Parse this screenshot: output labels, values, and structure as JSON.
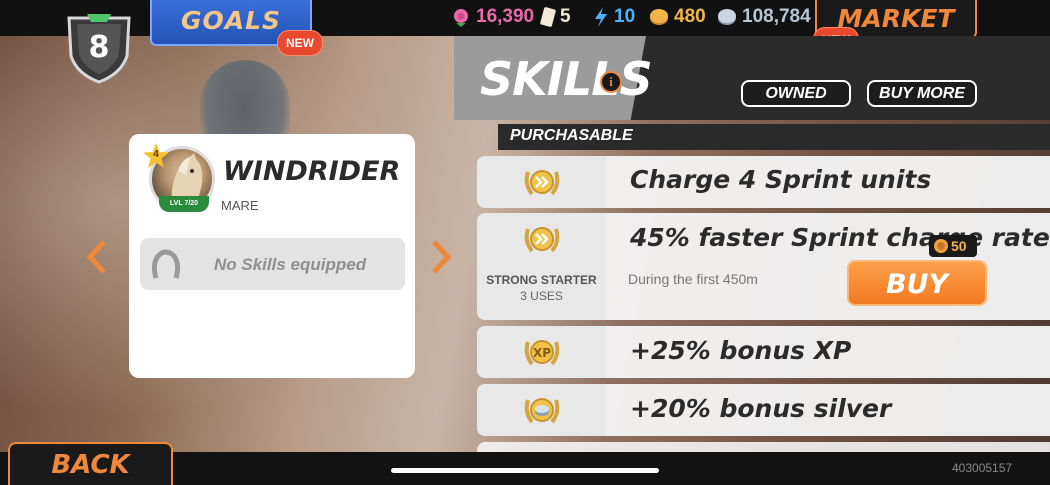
{
  "header": {
    "player_level": "8",
    "goals": {
      "label": "GOALS",
      "badge": "NEW"
    },
    "market": {
      "label": "MARKET",
      "badge": "NEW"
    },
    "resources": [
      {
        "icon": "rose-icon",
        "value": "16,390",
        "color": "#e86aa8"
      },
      {
        "icon": "ticket-icon",
        "value": "5",
        "color": "#f2ead8"
      },
      {
        "icon": "energy-icon",
        "value": "10",
        "color": "#4fb0ff"
      },
      {
        "icon": "gold-coin-icon",
        "value": "480",
        "color": "#f0b44a"
      },
      {
        "icon": "silver-coin-icon",
        "value": "108,784",
        "color": "#b7c7d3"
      }
    ]
  },
  "skills": {
    "title": "SKILLS",
    "owned_label": "OWNED",
    "buy_more_label": "BUY MORE",
    "section_label": "PURCHASABLE",
    "items": [
      {
        "title": "Charge 4 Sprint units",
        "medal_icon": "sprint-chevrons-icon"
      },
      {
        "title": "45% faster Sprint charge rate",
        "medal_icon": "sprint-chevrons-icon",
        "name": "STRONG STARTER",
        "uses": "3 USES",
        "description": "During the first 450m",
        "price": "50",
        "buy_label": "BUY"
      },
      {
        "title": "+25% bonus XP",
        "medal_icon": "xp-icon"
      },
      {
        "title": "+20% bonus silver",
        "medal_icon": "silver-coins-icon"
      }
    ]
  },
  "horse": {
    "name": "WINDRIDER",
    "type": "MARE",
    "star_level": "4",
    "level_text": "LVL 7/20",
    "no_skills_text": "No Skills equipped"
  },
  "footer": {
    "back_label": "BACK",
    "build_id": "403005157"
  }
}
